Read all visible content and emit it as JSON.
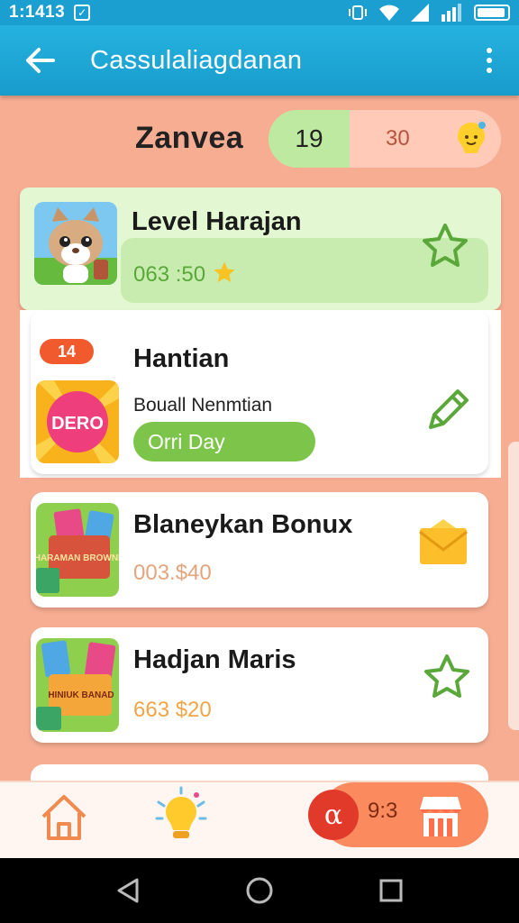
{
  "status_bar": {
    "time": "1:1413"
  },
  "app_bar": {
    "title": "Cassulaliagdanan"
  },
  "header": {
    "user_name": "Zanvea",
    "score_green": "19",
    "score_red": "30"
  },
  "cards": [
    {
      "title": "Level Harajan",
      "subtitle": "063 :50"
    },
    {
      "badge": "14",
      "title": "Hantian",
      "subtitle": "Bouall Nenmtian",
      "button": "Orri Day",
      "thumb_text": "DERO"
    },
    {
      "title": "Blaneykan Bonux",
      "subtitle": "003.$40",
      "thumb_text": "HARAMAN BROWND"
    },
    {
      "title": "Hadjan Maris",
      "subtitle": "663 $20",
      "thumb_text": "HINIUK BANAD"
    }
  ],
  "bottom_nav": {
    "shop_coin_symbol": "α",
    "shop_count": "9:3"
  },
  "colors": {
    "primary": "#1a9fd0",
    "background": "#f7ad92",
    "green": "#7cc44a",
    "accent_red": "#e23a2a"
  },
  "icons": [
    "back-arrow-icon",
    "more-vert-icon",
    "lightbulb-icon",
    "star-outline-icon",
    "pencil-icon",
    "envelope-icon",
    "home-icon",
    "store-icon"
  ]
}
